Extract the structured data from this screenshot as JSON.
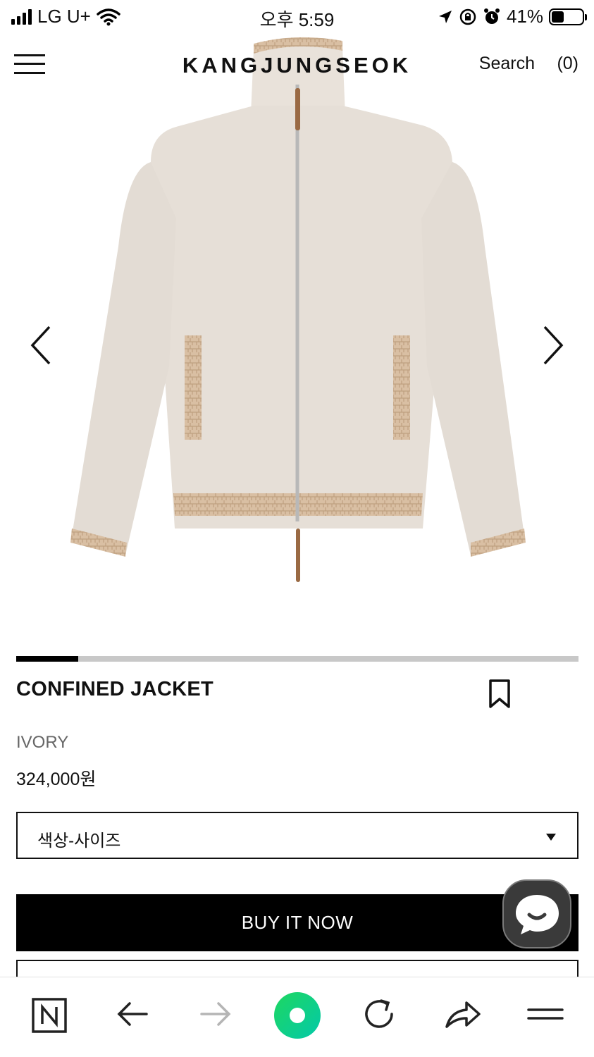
{
  "status_bar": {
    "carrier": "LG U+",
    "time": "오후 5:59",
    "battery": "41%",
    "battery_level": 0.41
  },
  "header": {
    "brand": "KANGJUNGSEOK",
    "search_label": "Search",
    "cart_label": "(0)"
  },
  "gallery": {
    "progress": 0.11
  },
  "product": {
    "name": "CONFINED JACKET",
    "color": "IVORY",
    "price": "324,000원",
    "option_label": "색상-사이즈",
    "buy_label": "BUY IT NOW"
  },
  "colors": {
    "accent": "#000000",
    "naver_green": "#03CF5D",
    "chat_bg": "#3a3a3a"
  },
  "toolbar": {
    "icons": [
      "naver-n-icon",
      "back-arrow-icon",
      "forward-arrow-icon",
      "naver-home-icon",
      "refresh-icon",
      "share-icon",
      "menu-icon"
    ]
  }
}
